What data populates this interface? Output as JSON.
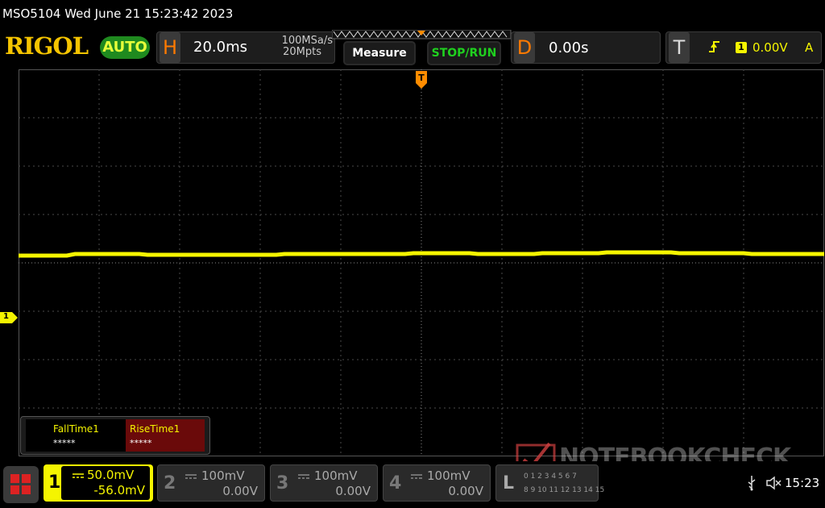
{
  "status": {
    "title": "MSO5104  Wed June 21 15:23:42 2023"
  },
  "header": {
    "brand": "RIGOL",
    "auto_label": "AUTO",
    "h": {
      "letter": "H",
      "timebase": "20.0ms",
      "sample_rate": "100MSa/s",
      "memory_depth": "20Mpts"
    },
    "measure_label": "Measure",
    "stop_run_label": "STOP/RUN",
    "d": {
      "letter": "D",
      "delay": "0.00s"
    },
    "t": {
      "letter": "T",
      "source": "1",
      "level": "0.00V",
      "mode": "A"
    }
  },
  "markers": {
    "trigger_marker": "T",
    "channel1_marker": "1"
  },
  "measurements": [
    {
      "name": "FallTime1",
      "value": "*****"
    },
    {
      "name": "RiseTime1",
      "value": "*****"
    }
  ],
  "channels": [
    {
      "num": "1",
      "scale": "50.0mV",
      "offset": "-56.0mV"
    },
    {
      "num": "2",
      "scale": "100mV",
      "offset": "0.00V"
    },
    {
      "num": "3",
      "scale": "100mV",
      "offset": "0.00V"
    },
    {
      "num": "4",
      "scale": "100mV",
      "offset": "0.00V"
    }
  ],
  "logic": {
    "letter": "L",
    "row1": "0 1 2 3 4 5 6 7",
    "row2": "8 9 10 11 12 13 14 15"
  },
  "system": {
    "time": "15:23"
  },
  "watermark": "NOTEBOOKCHECK",
  "colors": {
    "channel1": "#f5f500",
    "trigger": "#ff8c00",
    "green": "#1fd11f",
    "orange": "#ff7a00",
    "fall_bg": "#000000",
    "rise_bg": "#6a0a0a"
  }
}
